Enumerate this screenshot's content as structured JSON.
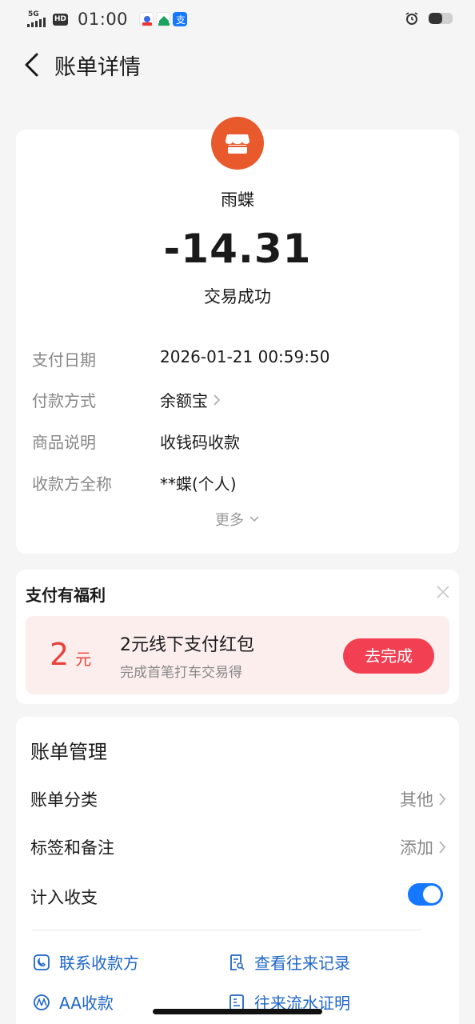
{
  "status_bar": {
    "network": "5G",
    "hd": "HD",
    "time": "01:00",
    "battery_level": 0.55
  },
  "header": {
    "title": "账单详情"
  },
  "bill": {
    "merchant_name": "雨蝶",
    "amount": "-14.31",
    "status": "交易成功",
    "details": [
      {
        "label": "支付日期",
        "value": "2026-01-21 00:59:50"
      },
      {
        "label": "付款方式",
        "value": "余额宝"
      },
      {
        "label": "商品说明",
        "value": "收钱码收款"
      },
      {
        "label": "收款方全称",
        "value": "**蝶(个人)"
      }
    ],
    "more_label": "更多"
  },
  "benefit": {
    "title": "支付有福利",
    "coupon_amount": "2",
    "coupon_unit": "元",
    "coupon_title": "2元线下支付红包",
    "coupon_desc": "完成首笔打车交易得",
    "action_label": "去完成"
  },
  "manage": {
    "title": "账单管理",
    "category_label": "账单分类",
    "category_value": "其他",
    "tags_label": "标签和备注",
    "tags_value": "添加",
    "include_label": "计入收支",
    "include_enabled": true,
    "links": {
      "contact": "联系收款方",
      "history": "查看往来记录",
      "aa": "AA收款",
      "proof": "往来流水证明"
    }
  },
  "colors": {
    "merchant_logo": "#e8592c",
    "accent_blue": "#1677ff",
    "link_blue": "#1e66c8",
    "coupon_red": "#e8403a",
    "button_red": "#f23f51"
  }
}
